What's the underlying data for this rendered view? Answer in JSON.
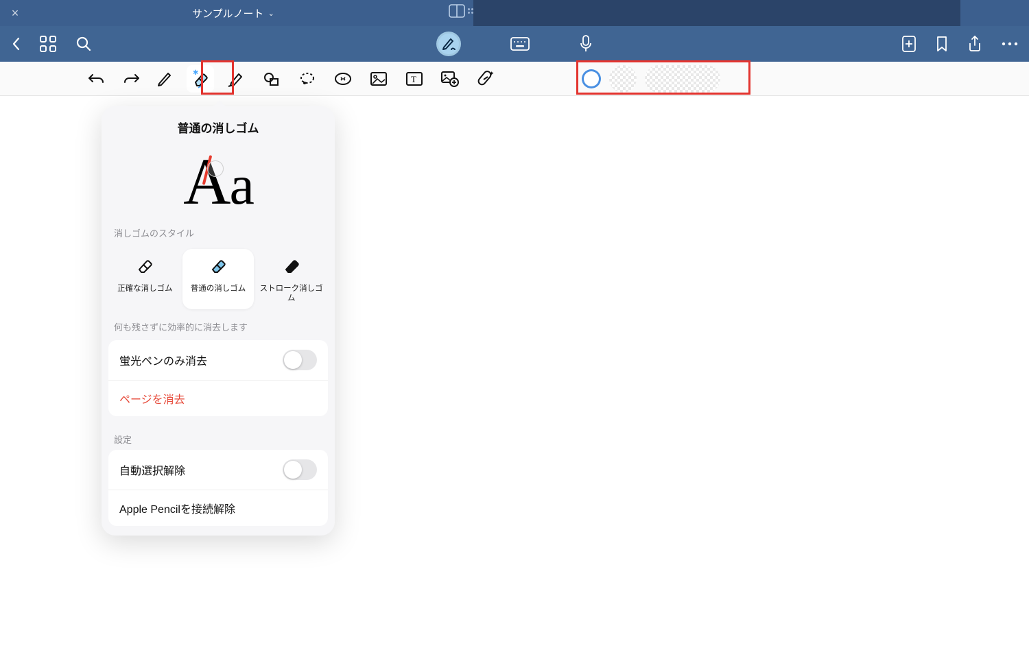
{
  "titlebar": {
    "doc_name": "サンプルノート"
  },
  "popover": {
    "title": "普通の消しゴム",
    "preview_text_cap": "A",
    "preview_text_low": "a",
    "style_section": "消しゴムのスタイル",
    "styles": [
      {
        "label": "正確な消しゴム"
      },
      {
        "label": "普通の消しゴム"
      },
      {
        "label": "ストローク消しゴム"
      }
    ],
    "desc": "何も残さずに効率的に消去します",
    "row_highlighter": "蛍光ペンのみ消去",
    "row_clear_page": "ページを消去",
    "settings_section": "設定",
    "row_autodeselect": "自動選択解除",
    "row_pencil_disconnect": "Apple Pencilを接続解除"
  }
}
